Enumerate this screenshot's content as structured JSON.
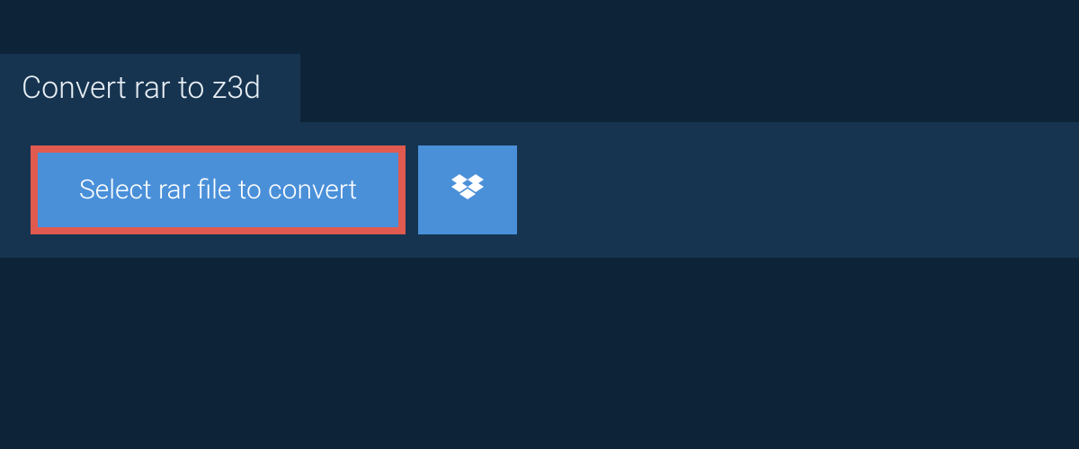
{
  "header": {
    "title": "Convert rar to z3d"
  },
  "actions": {
    "select_file_label": "Select rar file to convert"
  },
  "colors": {
    "bg": "#0d2438",
    "panel": "#163450",
    "button": "#4a90d9",
    "highlight_border": "#e05a4f",
    "text_light": "#e8eef4",
    "text_white": "#ffffff"
  }
}
